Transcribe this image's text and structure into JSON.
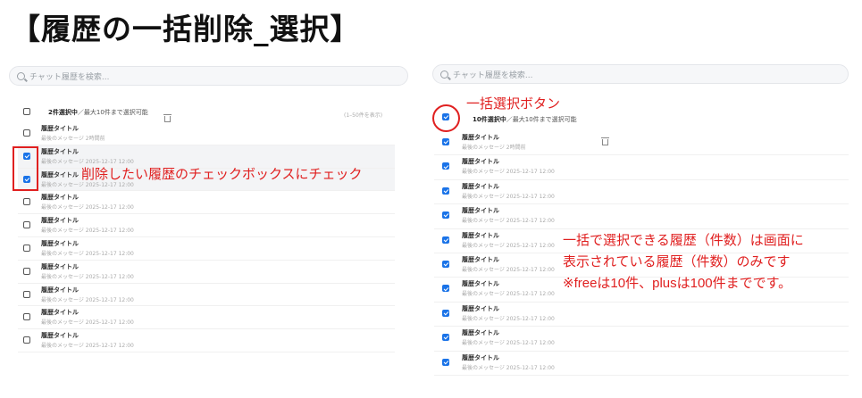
{
  "title": "【履歴の一括削除_選択】",
  "left": {
    "search_placeholder": "チャット履歴を検索...",
    "selected_count": "2件選択中",
    "limit_text": "／最大10件まで選択可能",
    "range_text": "(1–50件を表示)",
    "rows": [
      {
        "title": "履歴タイトル",
        "subtitle": "最後のメッセージ 2時間前",
        "checked": false
      },
      {
        "title": "履歴タイトル",
        "subtitle": "最後のメッセージ 2025-12-17 12:00",
        "checked": true
      },
      {
        "title": "履歴タイトル",
        "subtitle": "最後のメッセージ 2025-12-17 12:00",
        "checked": true
      },
      {
        "title": "履歴タイトル",
        "subtitle": "最後のメッセージ 2025-12-17 12:00",
        "checked": false
      },
      {
        "title": "履歴タイトル",
        "subtitle": "最後のメッセージ 2025-12-17 12:00",
        "checked": false
      },
      {
        "title": "履歴タイトル",
        "subtitle": "最後のメッセージ 2025-12-17 12:00",
        "checked": false
      },
      {
        "title": "履歴タイトル",
        "subtitle": "最後のメッセージ 2025-12-17 12:00",
        "checked": false
      },
      {
        "title": "履歴タイトル",
        "subtitle": "最後のメッセージ 2025-12-17 12:00",
        "checked": false
      },
      {
        "title": "履歴タイトル",
        "subtitle": "最後のメッセージ 2025-12-17 12:00",
        "checked": false
      },
      {
        "title": "履歴タイトル",
        "subtitle": "最後のメッセージ 2025-12-17 12:00",
        "checked": false
      }
    ],
    "annotation": "削除したい履歴のチェックボックスにチェック"
  },
  "right": {
    "search_placeholder": "チャット履歴を検索...",
    "selected_count": "10件選択中",
    "limit_text": "／最大10件まで選択可能",
    "rows": [
      {
        "title": "履歴タイトル",
        "subtitle": "最後のメッセージ 2時間前",
        "checked": true
      },
      {
        "title": "履歴タイトル",
        "subtitle": "最後のメッセージ 2025-12-17 12:00",
        "checked": true
      },
      {
        "title": "履歴タイトル",
        "subtitle": "最後のメッセージ 2025-12-17 12:00",
        "checked": true
      },
      {
        "title": "履歴タイトル",
        "subtitle": "最後のメッセージ 2025-12-17 12:00",
        "checked": true
      },
      {
        "title": "履歴タイトル",
        "subtitle": "最後のメッセージ 2025-12-17 12:00",
        "checked": true
      },
      {
        "title": "履歴タイトル",
        "subtitle": "最後のメッセージ 2025-12-17 12:00",
        "checked": true
      },
      {
        "title": "履歴タイトル",
        "subtitle": "最後のメッセージ 2025-12-17 12:00",
        "checked": true
      },
      {
        "title": "履歴タイトル",
        "subtitle": "最後のメッセージ 2025-12-17 12:00",
        "checked": true
      },
      {
        "title": "履歴タイトル",
        "subtitle": "最後のメッセージ 2025-12-17 12:00",
        "checked": true
      },
      {
        "title": "履歴タイトル",
        "subtitle": "最後のメッセージ 2025-12-17 12:00",
        "checked": true
      }
    ],
    "annotation_button": "一括選択ボタン",
    "annotation_note": [
      "一括で選択できる履歴（件数）は画面に",
      "表示されている履歴（件数）のみです",
      "※freeは10件、plusは100件までです。"
    ]
  },
  "colors": {
    "accent": "#1a73e8",
    "annotation": "#e02020"
  }
}
